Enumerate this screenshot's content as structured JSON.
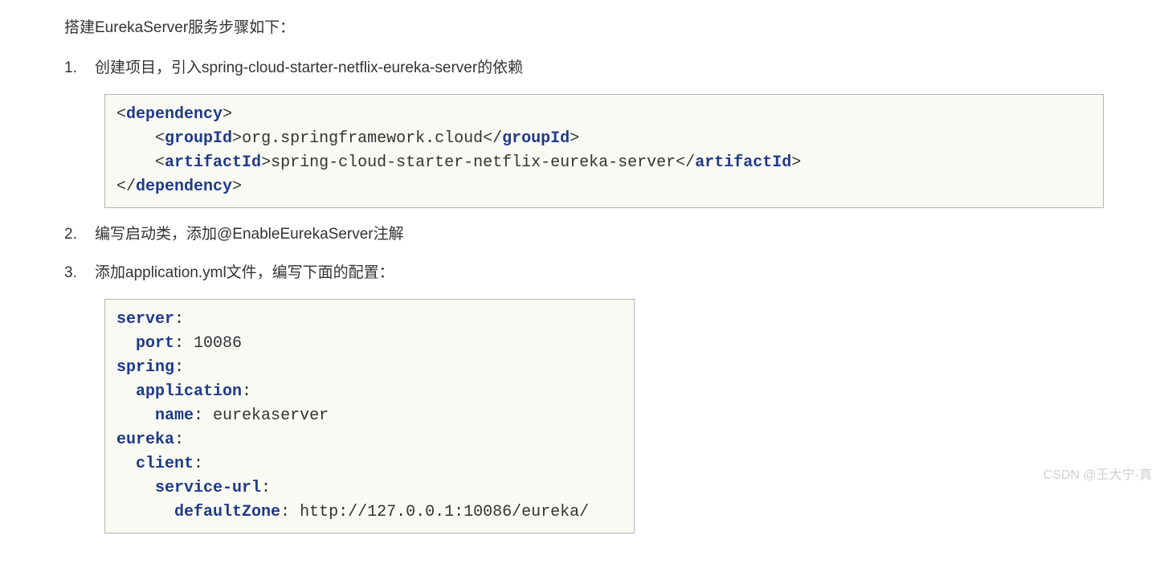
{
  "intro": "搭建EurekaServer服务步骤如下：",
  "steps": [
    {
      "number": "1.",
      "text": "创建项目，引入spring-cloud-starter-netflix-eureka-server的依赖"
    },
    {
      "number": "2.",
      "text": "编写启动类，添加@EnableEurekaServer注解"
    },
    {
      "number": "3.",
      "text": "添加application.yml文件，编写下面的配置："
    }
  ],
  "xml": {
    "dependency_open": "dependency",
    "groupId_open": "groupId",
    "groupId_value": "org.springframework.cloud",
    "groupId_close": "groupId",
    "artifactId_open": "artifactId",
    "artifactId_value": "spring-cloud-starter-netflix-eureka-server",
    "artifactId_close": "artifactId",
    "dependency_close": "dependency"
  },
  "yaml": {
    "server": "server",
    "port_key": "port",
    "port_value": " 10086",
    "spring": "spring",
    "application": "application",
    "name_key": "name",
    "name_value": " eurekaserver",
    "eureka": "eureka",
    "client": "client",
    "service_url": "service-url",
    "defaultZone_key": "defaultZone",
    "defaultZone_value": " http://127.0.0.1:10086/eureka/"
  },
  "watermark": "CSDN @王大宁-真"
}
